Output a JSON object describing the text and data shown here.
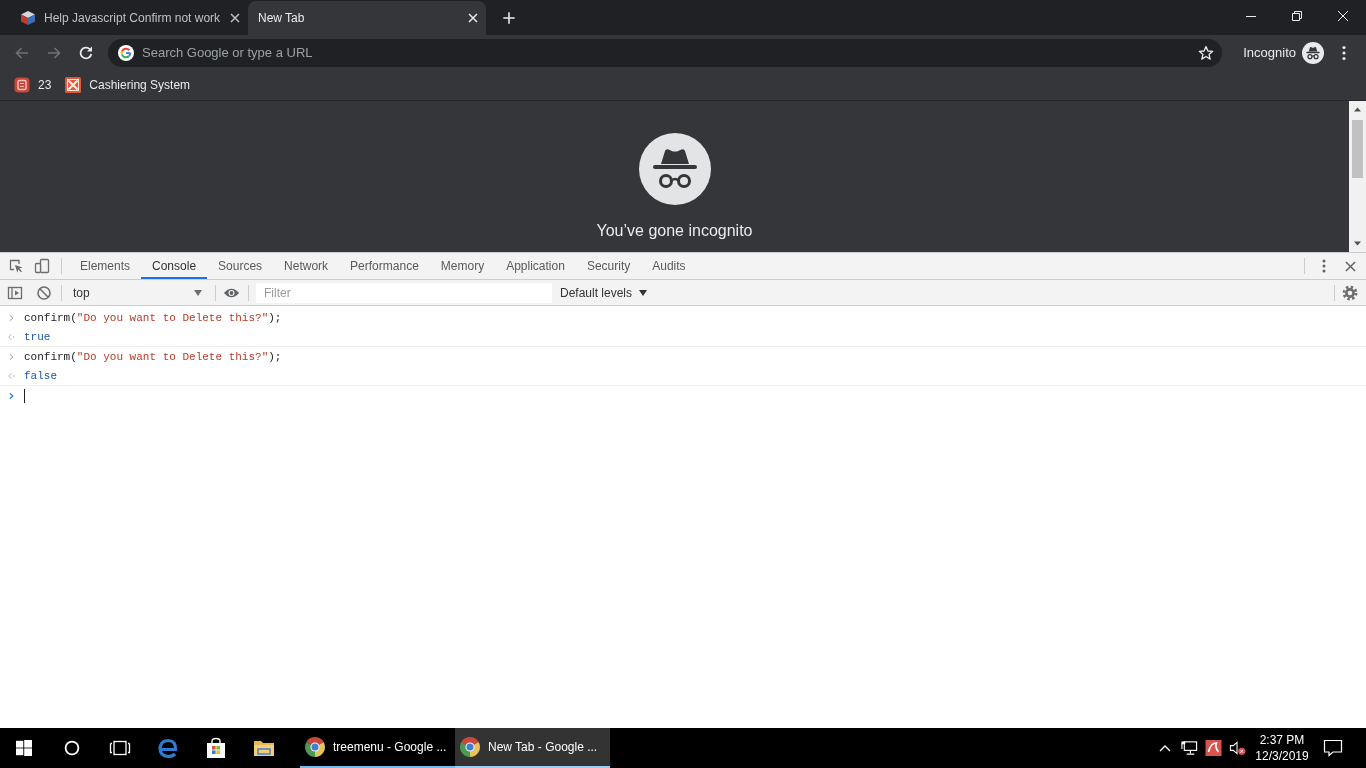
{
  "browser": {
    "tabs": [
      {
        "title": "Help Javascript Confirm not work",
        "selected": false
      },
      {
        "title": "New Tab",
        "selected": true
      }
    ],
    "omnibox": {
      "placeholder": "Search Google or type a URL"
    },
    "profile": {
      "label": "Incognito"
    },
    "bookmarks": [
      {
        "label": "23"
      },
      {
        "label": "Cashiering System"
      }
    ]
  },
  "page": {
    "heading": "You’ve gone incognito"
  },
  "devtools": {
    "tabs": [
      {
        "label": "Elements",
        "selected": false
      },
      {
        "label": "Console",
        "selected": true
      },
      {
        "label": "Sources",
        "selected": false
      },
      {
        "label": "Network",
        "selected": false
      },
      {
        "label": "Performance",
        "selected": false
      },
      {
        "label": "Memory",
        "selected": false
      },
      {
        "label": "Application",
        "selected": false
      },
      {
        "label": "Security",
        "selected": false
      },
      {
        "label": "Audits",
        "selected": false
      }
    ],
    "console_toolbar": {
      "context": "top",
      "filter_placeholder": "Filter",
      "levels": "Default levels"
    },
    "console": [
      {
        "command": [
          {
            "kind": "plain",
            "text": "confirm("
          },
          {
            "kind": "string",
            "text": "\"Do you want to Delete this?\""
          },
          {
            "kind": "plain",
            "text": ");"
          }
        ],
        "result": "true"
      },
      {
        "command": [
          {
            "kind": "plain",
            "text": "confirm("
          },
          {
            "kind": "string",
            "text": "\"Do you want to Delete this?\""
          },
          {
            "kind": "plain",
            "text": ");"
          }
        ],
        "result": "false"
      }
    ]
  },
  "taskbar": {
    "windows": [
      {
        "label": "treemenu - Google ...",
        "selected": false
      },
      {
        "label": "New Tab - Google ...",
        "selected": true
      }
    ],
    "clock": {
      "time": "2:37 PM",
      "date": "12/3/2019"
    }
  }
}
